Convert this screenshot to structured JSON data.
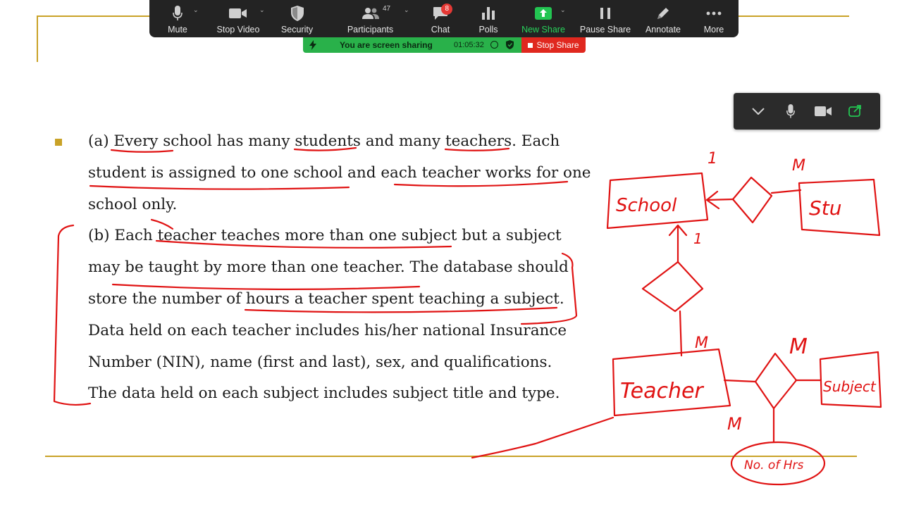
{
  "toolbar": {
    "items": [
      {
        "label": "Mute",
        "icon": "microphone-icon"
      },
      {
        "label": "Stop Video",
        "icon": "video-camera-icon"
      },
      {
        "label": "Security",
        "icon": "shield-icon"
      },
      {
        "label": "Participants",
        "icon": "participants-icon",
        "count": "47"
      },
      {
        "label": "Chat",
        "icon": "chat-icon",
        "badge": "8"
      },
      {
        "label": "Polls",
        "icon": "polls-icon"
      },
      {
        "label": "New Share",
        "icon": "share-arrow-icon"
      },
      {
        "label": "Pause Share",
        "icon": "pause-icon"
      },
      {
        "label": "Annotate",
        "icon": "pencil-icon"
      },
      {
        "label": "More",
        "icon": "ellipsis-icon"
      }
    ]
  },
  "share_banner": {
    "message": "You are screen sharing",
    "elapsed": "01:05:32",
    "stop_label": "Stop Share"
  },
  "slide": {
    "lines": [
      "(a) Every school has many students and many teachers. Each",
      "student is assigned to one school and each teacher works for one",
      "school only.",
      "(b) Each teacher teaches more than one subject but a subject",
      "may be taught by more than one teacher. The database should",
      "store the number of hours a teacher spent teaching a subject.",
      "Data held on each teacher includes his/her national Insurance",
      "Number (NIN), name (first and last), sex, and qualifications.",
      "The data held on each subject includes subject title and type."
    ]
  },
  "annotations": {
    "school": "School",
    "student": "Stu",
    "teacher": "Teacher",
    "subject": "Subject",
    "hours": "No. of Hrs",
    "one_a": "1",
    "one_b": "1",
    "many_a": "M",
    "many_b": "M",
    "many_c": "M",
    "many_d": "M"
  },
  "colors": {
    "ink": "#e01313",
    "gold": "#c9a227",
    "toolbar_bg": "#232323",
    "share_green": "#29b14a",
    "stop_red": "#e0281f"
  }
}
